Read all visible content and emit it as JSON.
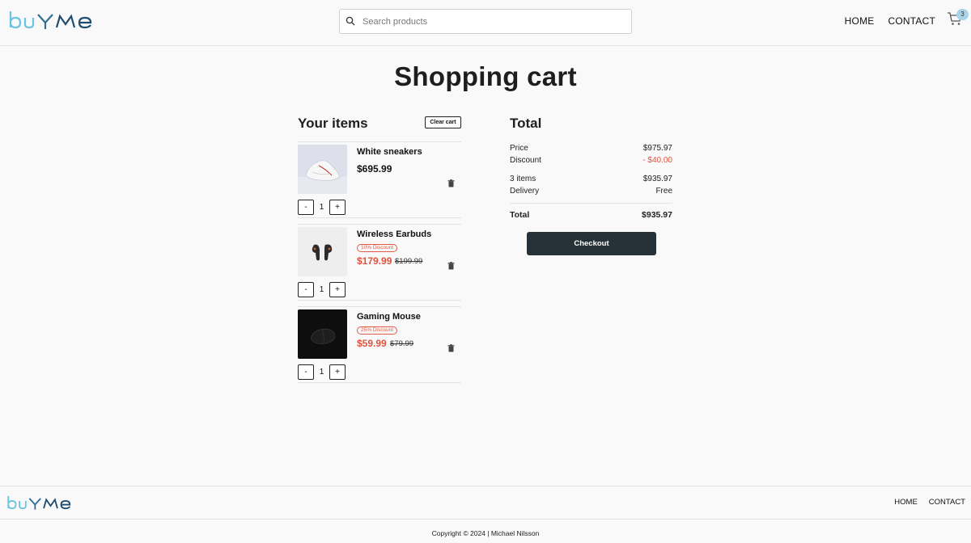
{
  "brand": {
    "logo_text": "buyme",
    "colors": {
      "blue_light": "#6cc4e3",
      "blue_dark": "#1f4c6e"
    }
  },
  "header": {
    "search_placeholder": "Search products",
    "nav": [
      "HOME",
      "CONTACT"
    ],
    "cart_count": "3"
  },
  "page_title": "Shopping cart",
  "cart": {
    "heading": "Your items",
    "clear_label": "Clear cart",
    "items": [
      {
        "name": "White sneakers",
        "price": "$695.99",
        "discount": "",
        "old_price": "",
        "qty": "1",
        "minus": "-",
        "plus": "+",
        "image_icon": "sneaker-image"
      },
      {
        "name": "Wireless Earbuds",
        "price": "$179.99",
        "discount": "10% Discount",
        "old_price": "$199.99",
        "qty": "1",
        "minus": "-",
        "plus": "+",
        "image_icon": "earbuds-image"
      },
      {
        "name": "Gaming Mouse",
        "price": "$59.99",
        "discount": "25% Discount",
        "old_price": "$79.99",
        "qty": "1",
        "minus": "-",
        "plus": "+",
        "image_icon": "mouse-image"
      }
    ]
  },
  "summary": {
    "heading": "Total",
    "price_label": "Price",
    "price_value": "$975.97",
    "discount_label": "Discount",
    "discount_value": "- $40.00",
    "items_label": "3 items",
    "items_value": "$935.97",
    "delivery_label": "Delivery",
    "delivery_value": "Free",
    "total_label": "Total",
    "total_value": "$935.97",
    "checkout_label": "Checkout"
  },
  "footer": {
    "nav": [
      "HOME",
      "CONTACT"
    ],
    "copyright": "Copyright © 2024 | Michael Nilsson"
  }
}
